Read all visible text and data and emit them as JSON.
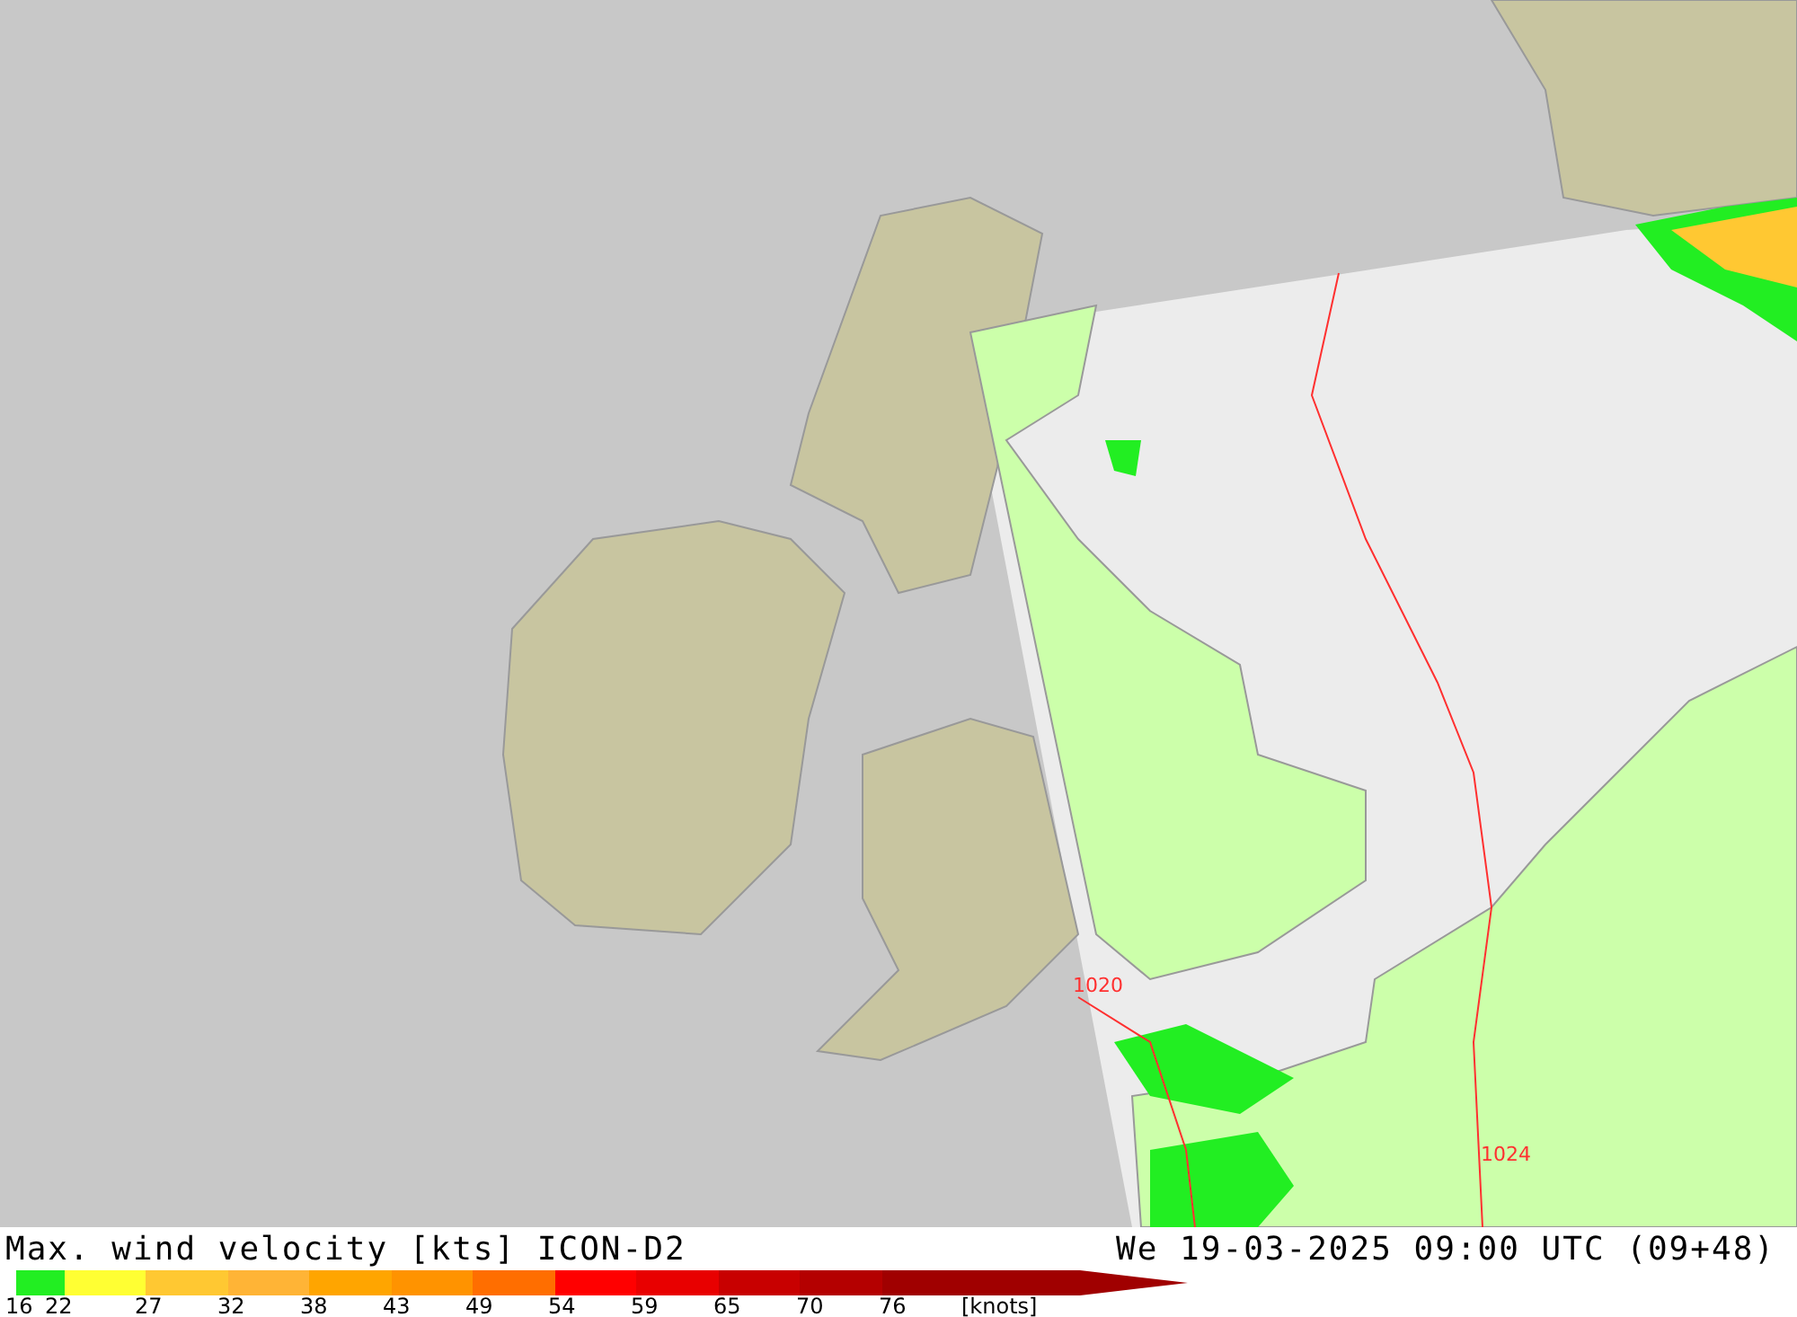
{
  "map": {
    "isobar_labels": [
      {
        "text": "1020"
      },
      {
        "text": "1024"
      }
    ]
  },
  "footer": {
    "title": "Max. wind velocity [kts] ICON-D2",
    "valid_time": "We 19-03-2025 09:00 UTC (09+48)",
    "legend": {
      "bins": [
        {
          "color": "#22ee22"
        },
        {
          "color": "#ffff33"
        },
        {
          "color": "#ffc832"
        },
        {
          "color": "#ffb436"
        },
        {
          "color": "#ffa500"
        },
        {
          "color": "#ff9300"
        },
        {
          "color": "#ff6e00"
        },
        {
          "color": "#ff0000"
        },
        {
          "color": "#e80000"
        },
        {
          "color": "#c80000"
        },
        {
          "color": "#b40000"
        },
        {
          "color": "#a00000"
        }
      ],
      "ticks": [
        "16",
        "22",
        "27",
        "32",
        "38",
        "43",
        "49",
        "54",
        "59",
        "65",
        "70",
        "76"
      ],
      "unit": "[knots]"
    }
  }
}
